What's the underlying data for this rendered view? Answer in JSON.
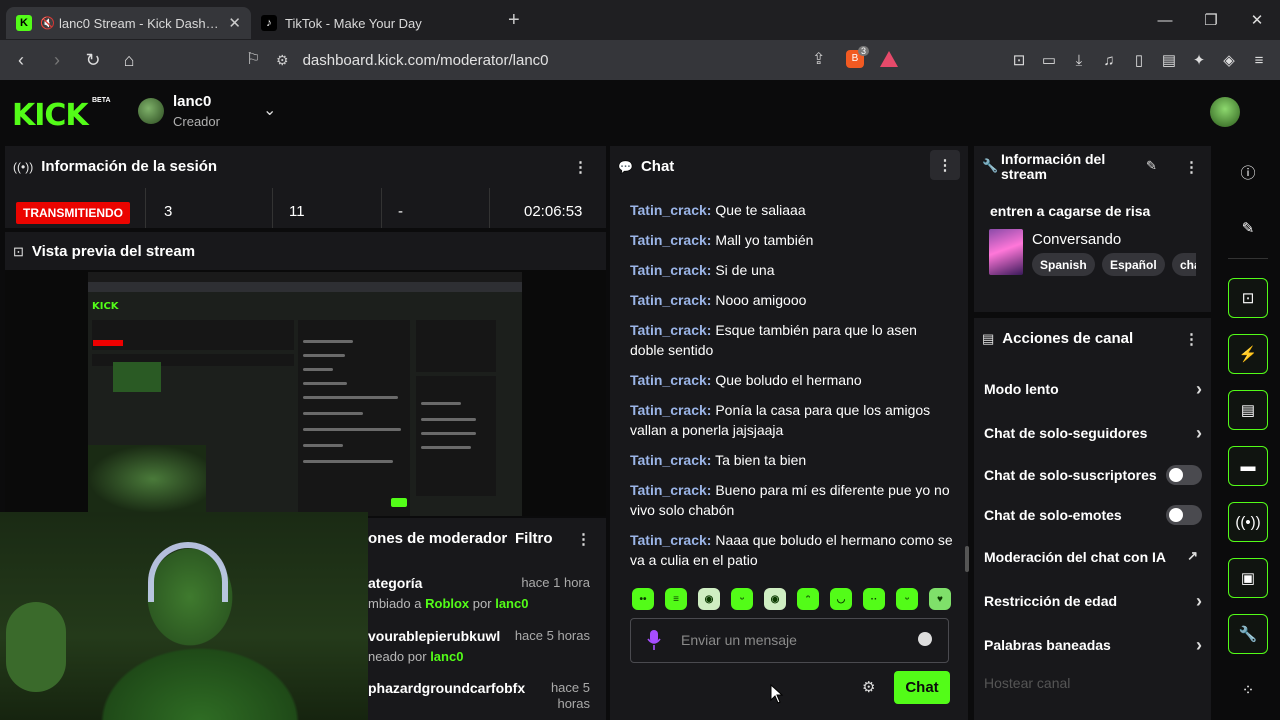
{
  "browser": {
    "tabs": [
      {
        "title": "lanc0 Stream - Kick Dashboard",
        "active": true
      },
      {
        "title": "TikTok - Make Your Day",
        "active": false
      }
    ],
    "url": "dashboard.kick.com/moderator/lanc0",
    "brave_count": "3"
  },
  "kick": {
    "logo": "KICK",
    "beta": "BETA",
    "username": "lanc0",
    "role": "Creador"
  },
  "session": {
    "title": "Información de la sesión",
    "status": "TRANSMITIENDO",
    "stats": [
      "3",
      "11",
      "-",
      "02:06:53"
    ]
  },
  "preview": {
    "title": "Vista previa del stream"
  },
  "mod_actions": {
    "title": "ones de moderador",
    "filter": "Filtro",
    "rows": [
      {
        "name": "ategoría",
        "time": "hace 1 hora",
        "sub_prefix": "mbiado a",
        "target": "Roblox",
        "by": "por",
        "user": "lanc0"
      },
      {
        "name": "vourablepierubkuwl",
        "time": "hace 5 horas",
        "sub_prefix": "neado por",
        "target": "",
        "by": "",
        "user": "lanc0"
      },
      {
        "name": "phazardgroundcarfobfx",
        "time": "hace 5 horas",
        "sub_prefix": "",
        "target": "",
        "by": "",
        "user": ""
      }
    ]
  },
  "chat": {
    "title": "Chat",
    "messages": [
      {
        "user": "Tatin_crack:",
        "text": "Que te saliaaa"
      },
      {
        "user": "Tatin_crack:",
        "text": "Mall yo también"
      },
      {
        "user": "Tatin_crack:",
        "text": "Si de una"
      },
      {
        "user": "Tatin_crack:",
        "text": "Nooo amigooo"
      },
      {
        "user": "Tatin_crack:",
        "text": "Esque también para que lo asen doble sentido"
      },
      {
        "user": "Tatin_crack:",
        "text": "Que boludo el hermano"
      },
      {
        "user": "Tatin_crack:",
        "text": "Ponía la casa para que los amigos vallan a ponerla jajsjaaja"
      },
      {
        "user": "Tatin_crack:",
        "text": "Ta bien ta bien"
      },
      {
        "user": "Tatin_crack:",
        "text": "Bueno para mí es diferente pue yo no vivo solo chabón"
      },
      {
        "user": "Tatin_crack:",
        "text": "Naaa que boludo el hermano como se va a culia en el patio"
      }
    ],
    "input_placeholder": "Enviar un mensaje",
    "send_label": "Chat"
  },
  "stream_info": {
    "title": "Información del stream",
    "description": "entren a cagarse de risa",
    "category": "Conversando",
    "tags": [
      "Spanish",
      "Español",
      "cha"
    ]
  },
  "channel_actions": {
    "title": "Acciones de canal",
    "items": [
      {
        "label": "Modo lento",
        "control": "chevron"
      },
      {
        "label": "Chat de solo-seguidores",
        "control": "chevron"
      },
      {
        "label": "Chat de solo-suscriptores",
        "control": "toggle"
      },
      {
        "label": "Chat de solo-emotes",
        "control": "toggle"
      },
      {
        "label": "Moderación del chat con IA",
        "control": "external"
      },
      {
        "label": "Restricción de edad",
        "control": "chevron"
      },
      {
        "label": "Palabras baneadas",
        "control": "chevron"
      },
      {
        "label": "Hostear canal",
        "control": "none"
      }
    ]
  },
  "colors": {
    "accent": "#53fc18",
    "live": "#eb0400",
    "panel": "#18181b",
    "background": "#0b0b0c",
    "chat_username": "#9bb5e8"
  }
}
